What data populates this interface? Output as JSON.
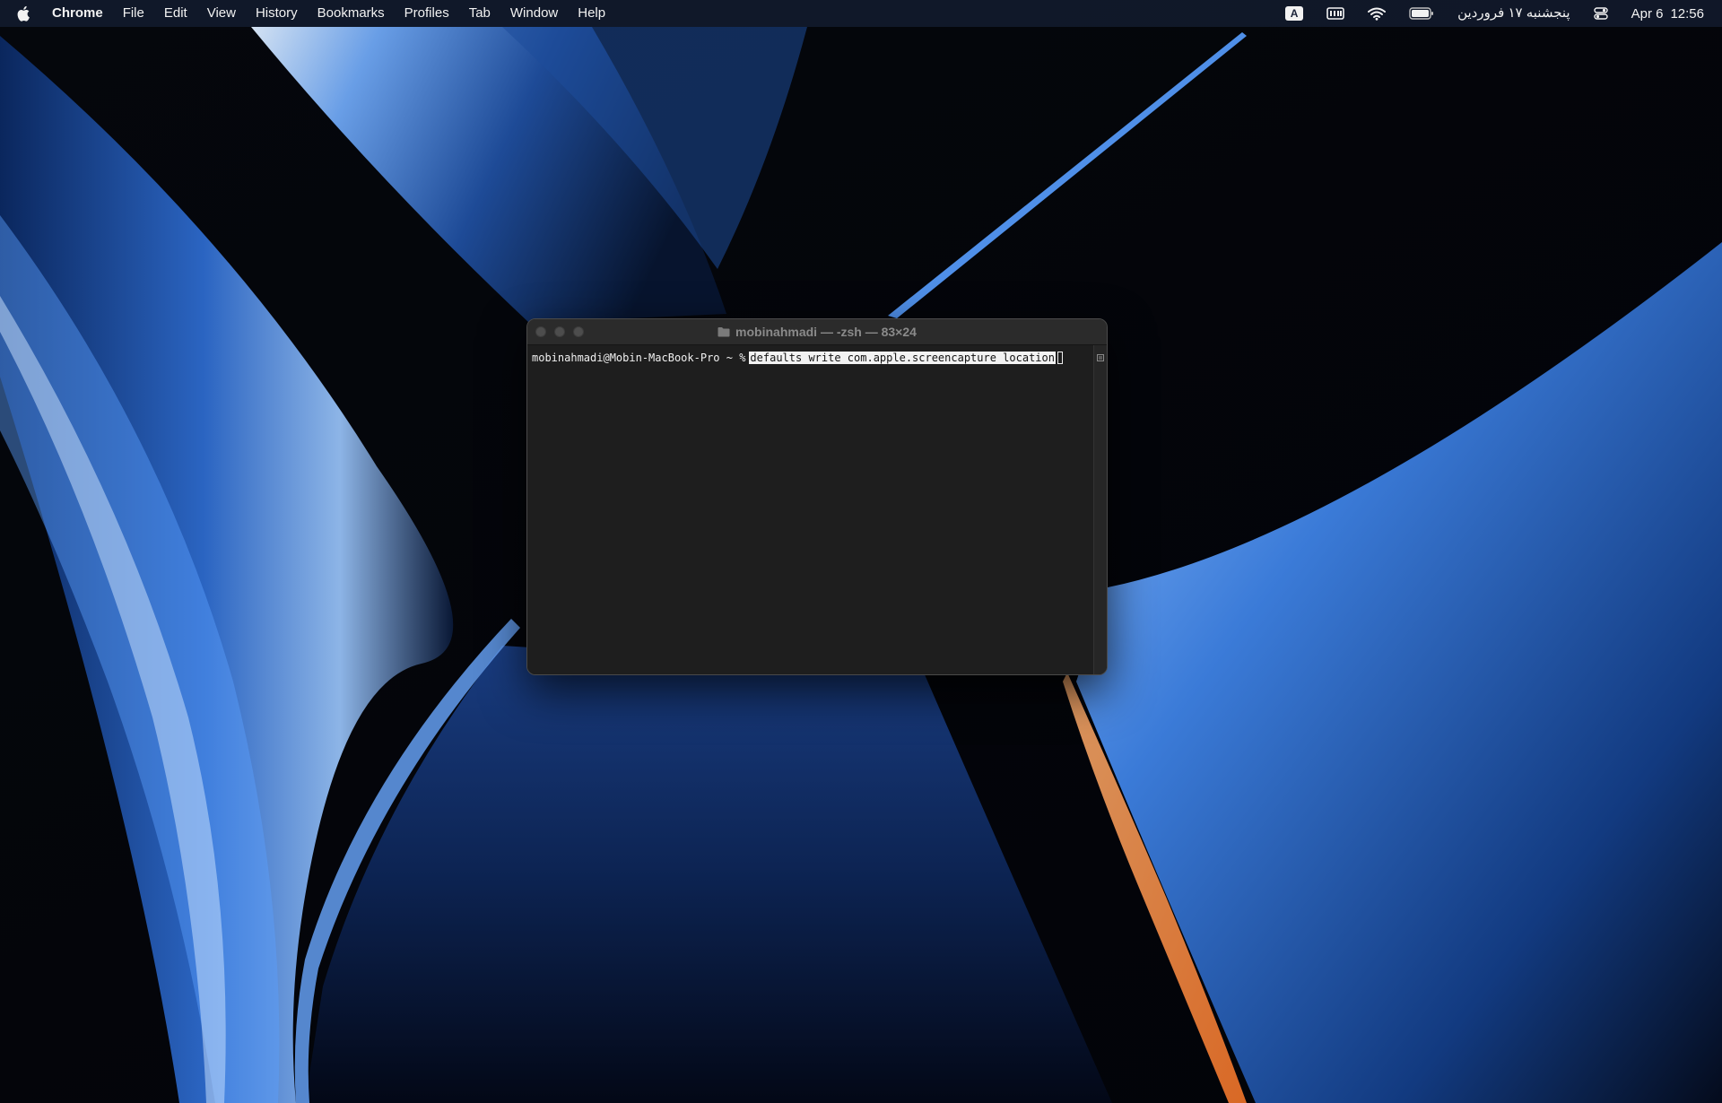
{
  "menubar": {
    "apple_icon": "apple-logo-icon",
    "app_name": "Chrome",
    "menus": [
      "File",
      "Edit",
      "View",
      "History",
      "Bookmarks",
      "Profiles",
      "Tab",
      "Window",
      "Help"
    ],
    "status": {
      "input_source": "A",
      "icons": [
        "keyboard-icon",
        "wifi-icon",
        "battery-icon",
        "control-center-icon"
      ],
      "persian_date": "پنجشنبه ۱۷ فروردین",
      "date": "Apr 6",
      "time": "12:56"
    }
  },
  "terminal": {
    "title": "mobinahmadi — -zsh — 83×24",
    "prompt": "mobinahmadi@Mobin-MacBook-Pro ~ %",
    "command": "defaults write com.apple.screencapture location"
  },
  "colors": {
    "menubar_bg": "#141c30",
    "terminal_bg": "#1e1e1e",
    "titlebar_bg": "#2b2b2b",
    "wallpaper_accent": "#3a7bd5"
  }
}
